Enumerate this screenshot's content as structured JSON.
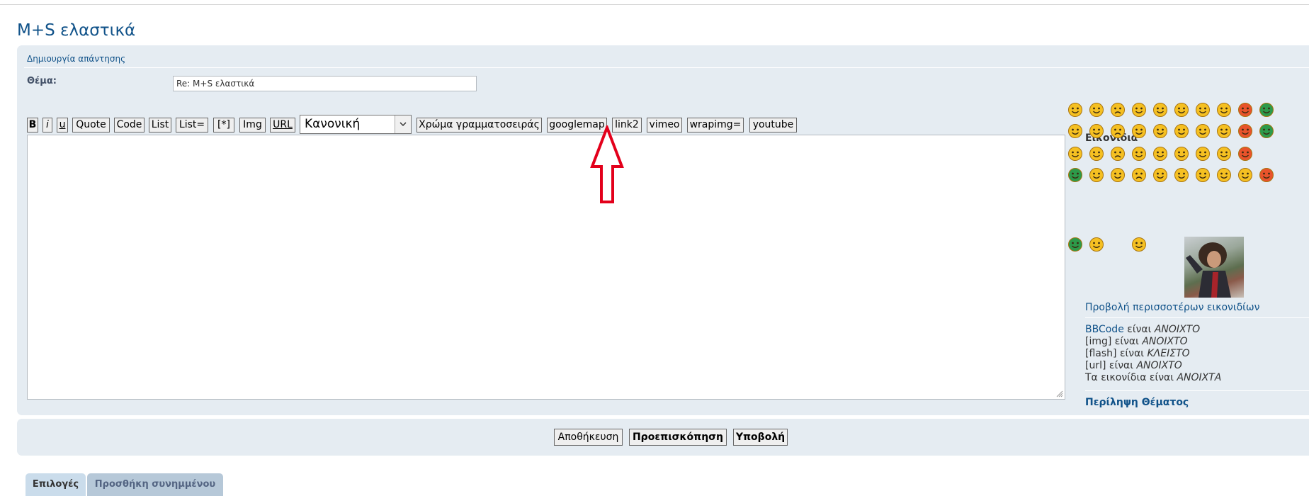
{
  "page_title": "M+S ελαστικά",
  "panel_heading": "Δημιουργία απάντησης",
  "subject": {
    "label": "Θέμα:",
    "value": "Re: M+S ελαστικά"
  },
  "toolbar": {
    "buttons": {
      "b": "B",
      "i": "i",
      "u": "u",
      "quote": "Quote",
      "code": "Code",
      "list": "List",
      "list_eq": "List=",
      "star": "[*]",
      "img": "Img",
      "url": "URL",
      "color": "Χρώμα γραμματοσειράς",
      "googlemap": "googlemap",
      "link2": "link2",
      "vimeo": "vimeo",
      "wrapimg": "wrapimg=",
      "youtube": "youtube"
    },
    "font_size": "Κανονική"
  },
  "smilies": {
    "title": "Εικονίδια",
    "more_link": "Προβολή περισσοτέρων εικονιδίων"
  },
  "status": {
    "bbcode_link": "BBCode",
    "bbcode_text": "είναι",
    "bbcode_value": "ΑΝΟΙΧΤΟ",
    "img_label": "[img]",
    "img_text": "είναι",
    "img_value": "ΑΝΟΙΧΤΟ",
    "flash_label": "[flash]",
    "flash_text": "είναι",
    "flash_value": "ΚΛΕΙΣΤΟ",
    "url_label": "[url]",
    "url_text": "είναι",
    "url_value": "ΑΝΟΙΧΤΟ",
    "smilies_label": "Τα εικονίδια",
    "smilies_text": "είναι",
    "smilies_value": "ΑΝΟΙΧΤΑ"
  },
  "topic_review": "Περίληψη Θέματος",
  "actions": {
    "save": "Αποθήκευση",
    "preview": "Προεπισκόπηση",
    "submit": "Υποβολή"
  },
  "tabs": {
    "options": "Επιλογές",
    "attachments": "Προσθήκη συνημμένου"
  },
  "colors": {
    "accent": "#105289",
    "panel": "#e5ecf2",
    "annotation_arrow": "#e3001b"
  }
}
